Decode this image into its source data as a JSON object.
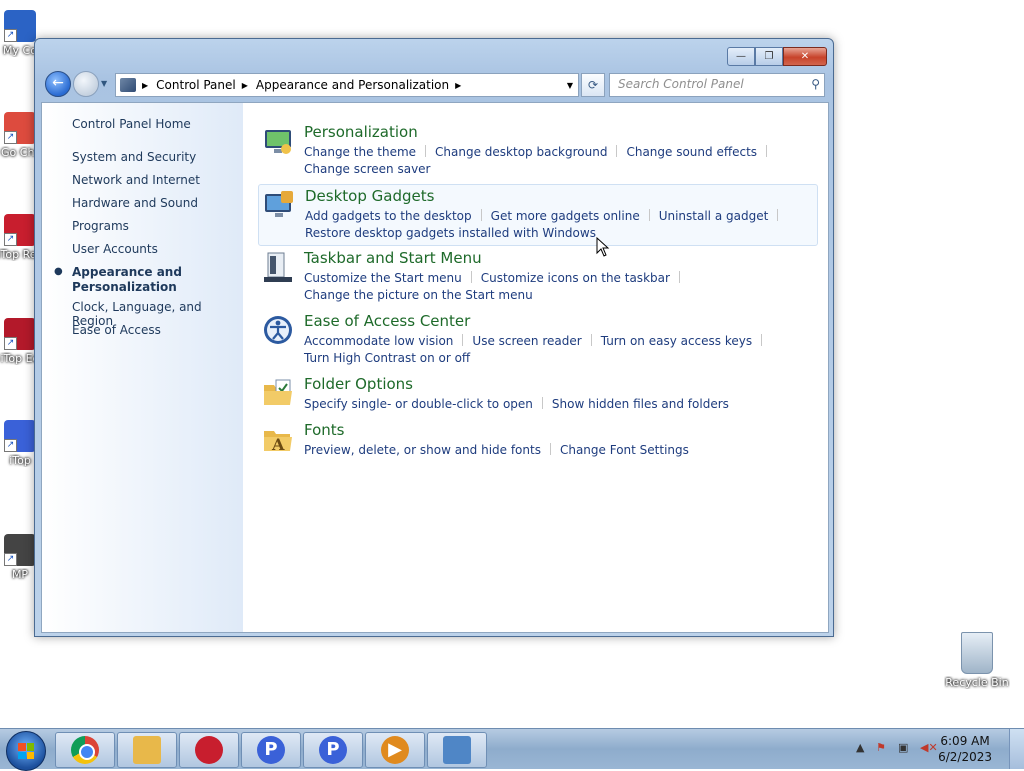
{
  "desktop": {
    "icons": [
      {
        "label": "My Co",
        "color": "#2b63c5"
      },
      {
        "label": "Go Chr",
        "color": "#dd4b3e"
      },
      {
        "label": "iTop Rec",
        "color": "#c81e2e"
      },
      {
        "label": "iTop Ed",
        "color": "#b3192a"
      },
      {
        "label": "iTop",
        "color": "#3a61d8"
      },
      {
        "label": "MP",
        "color": "#444444"
      }
    ],
    "recycle_bin": "Recycle Bin"
  },
  "window": {
    "caption": {
      "minimize": "—",
      "maximize": "❐",
      "close": "✕"
    },
    "nav": {
      "back": "←",
      "forward": "→",
      "history": "▼"
    },
    "address": {
      "crumbs": [
        "Control Panel",
        "Appearance and Personalization"
      ],
      "separator": "▶",
      "dropdown": "▼",
      "refresh": "⟳"
    },
    "search": {
      "placeholder": "Search Control Panel",
      "icon": "search-icon"
    },
    "sidebar": {
      "home": "Control Panel Home",
      "items": [
        {
          "label": "System and Security"
        },
        {
          "label": "Network and Internet"
        },
        {
          "label": "Hardware and Sound"
        },
        {
          "label": "Programs"
        },
        {
          "label": "User Accounts"
        },
        {
          "label": "Appearance and Personalization",
          "line1": "Appearance and",
          "line2": "Personalization",
          "active": true
        },
        {
          "label": "Clock, Language, and Region"
        },
        {
          "label": "Ease of Access"
        }
      ],
      "bullet": "●"
    },
    "sections": [
      {
        "title": "Personalization",
        "icon": "personalization-icon",
        "links": [
          "Change the theme",
          "Change desktop background",
          "Change sound effects",
          "Change screen saver"
        ]
      },
      {
        "title": "Desktop Gadgets",
        "icon": "desktop-gadgets-icon",
        "links": [
          "Add gadgets to the desktop",
          "Get more gadgets online",
          "Uninstall a gadget",
          "Restore desktop gadgets installed with Windows"
        ]
      },
      {
        "title": "Taskbar and Start Menu",
        "icon": "taskbar-icon",
        "links": [
          "Customize the Start menu",
          "Customize icons on the taskbar",
          "Change the picture on the Start menu"
        ]
      },
      {
        "title": "Ease of Access Center",
        "icon": "ease-of-access-icon",
        "links": [
          "Accommodate low vision",
          "Use screen reader",
          "Turn on easy access keys",
          "Turn High Contrast on or off"
        ]
      },
      {
        "title": "Folder Options",
        "icon": "folder-options-icon",
        "links": [
          "Specify single- or double-click to open",
          "Show hidden files and folders"
        ]
      },
      {
        "title": "Fonts",
        "icon": "fonts-icon",
        "links": [
          "Preview, delete, or show and hide fonts",
          "Change Font Settings"
        ]
      }
    ]
  },
  "taskbar": {
    "apps": [
      {
        "name": "chrome",
        "glyph": "",
        "color": "#db4437"
      },
      {
        "name": "explorer",
        "glyph": "",
        "color": "#e8b84a"
      },
      {
        "name": "itop-recorder",
        "glyph": "",
        "color": "#c81e2e"
      },
      {
        "name": "p-app-1",
        "glyph": "P",
        "color": "#3a61d8"
      },
      {
        "name": "p-app-2",
        "glyph": "P",
        "color": "#3a61d8"
      },
      {
        "name": "media",
        "glyph": "▶",
        "color": "#e08a1e"
      },
      {
        "name": "control-panel",
        "glyph": "",
        "color": "#4f86c6"
      }
    ],
    "tray": {
      "arrow": "▲",
      "time": "6:09 AM",
      "date": "6/2/2023"
    }
  }
}
